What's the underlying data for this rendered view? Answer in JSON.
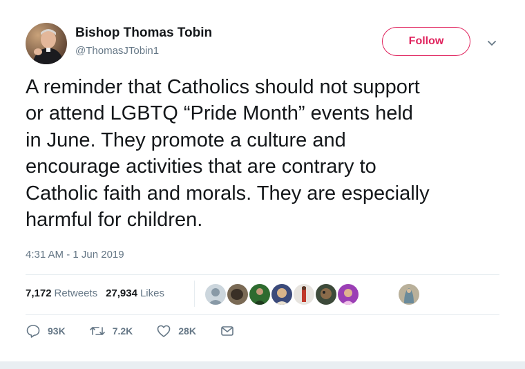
{
  "author": {
    "name": "Bishop Thomas Tobin",
    "handle": "@ThomasJTobin1"
  },
  "follow_label": "Follow",
  "tweet_text": "A reminder that Catholics should not support\nor attend LGBTQ “Pride Month” events held\nin June. They promote a culture and\nencourage activities that are contrary to\nCatholic faith and morals. They are especially\nharmful for children.",
  "timestamp": "4:31 AM - 1 Jun 2019",
  "stats": {
    "retweets_count": "7,172",
    "retweets_label": "Retweets",
    "likes_count": "27,934",
    "likes_label": "Likes"
  },
  "actions": {
    "replies": "93K",
    "retweets": "7.2K",
    "likes": "28K"
  },
  "colors": {
    "accent": "#e0245e",
    "secondary_text": "#657786",
    "primary_text": "#14171a"
  },
  "icons": [
    "chevron-down-icon",
    "reply-icon",
    "retweet-icon",
    "heart-icon",
    "mail-icon"
  ]
}
